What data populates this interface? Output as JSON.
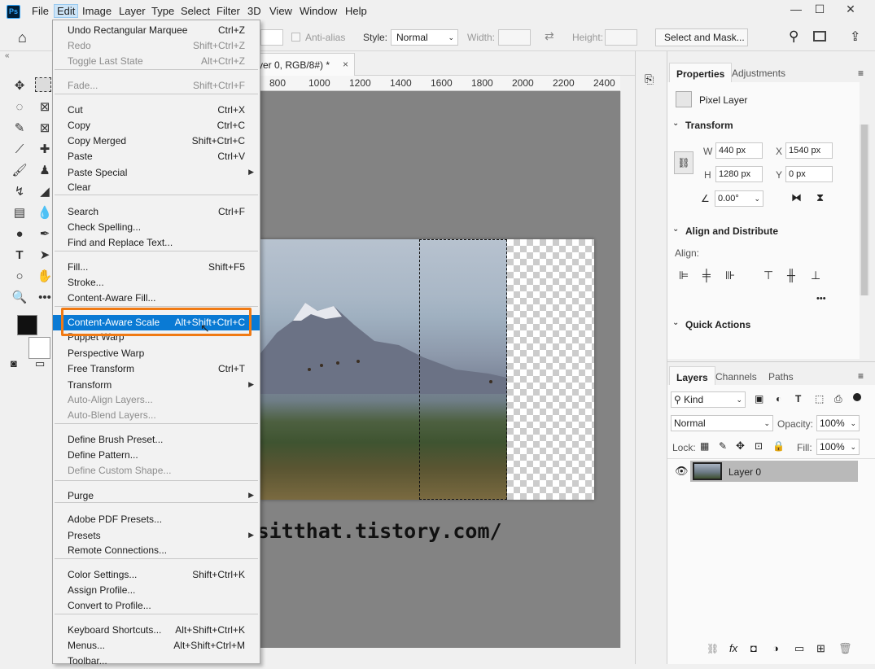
{
  "app": {
    "logo": "Ps"
  },
  "menubar": [
    "File",
    "Edit",
    "Image",
    "Layer",
    "Type",
    "Select",
    "Filter",
    "3D",
    "View",
    "Window",
    "Help"
  ],
  "window_controls": {
    "minimize": "—",
    "maximize": "☐",
    "close": "✕"
  },
  "options_bar": {
    "antialias_label": "Anti-alias",
    "style_label": "Style:",
    "style_value": "Normal",
    "width_label": "Width:",
    "height_label": "Height:",
    "select_mask_label": "Select and Mask..."
  },
  "doc_tab": {
    "title": "yer 0, RGB/8#) *",
    "close": "×"
  },
  "ruler_ticks": [
    "800",
    "1000",
    "1200",
    "1400",
    "1600",
    "1800",
    "2000",
    "2200",
    "2400"
  ],
  "watermark": "https://thisitthat.tistory.com/",
  "edit_menu": [
    {
      "label": "Undo Rectangular Marquee",
      "shortcut": "Ctrl+Z",
      "enabled": true
    },
    {
      "label": "Redo",
      "shortcut": "Shift+Ctrl+Z",
      "enabled": false
    },
    {
      "label": "Toggle Last State",
      "shortcut": "Alt+Ctrl+Z",
      "enabled": false
    },
    {
      "label": "Fade...",
      "shortcut": "Shift+Ctrl+F",
      "enabled": false
    },
    {
      "label": "Cut",
      "shortcut": "Ctrl+X",
      "enabled": true
    },
    {
      "label": "Copy",
      "shortcut": "Ctrl+C",
      "enabled": true
    },
    {
      "label": "Copy Merged",
      "shortcut": "Shift+Ctrl+C",
      "enabled": true
    },
    {
      "label": "Paste",
      "shortcut": "Ctrl+V",
      "enabled": true
    },
    {
      "label": "Paste Special",
      "shortcut": "",
      "enabled": true,
      "submenu": true
    },
    {
      "label": "Clear",
      "shortcut": "",
      "enabled": true
    },
    {
      "label": "Search",
      "shortcut": "Ctrl+F",
      "enabled": true
    },
    {
      "label": "Check Spelling...",
      "shortcut": "",
      "enabled": true
    },
    {
      "label": "Find and Replace Text...",
      "shortcut": "",
      "enabled": true
    },
    {
      "label": "Fill...",
      "shortcut": "Shift+F5",
      "enabled": true
    },
    {
      "label": "Stroke...",
      "shortcut": "",
      "enabled": true
    },
    {
      "label": "Content-Aware Fill...",
      "shortcut": "",
      "enabled": true
    },
    {
      "label": "Content-Aware Scale",
      "shortcut": "Alt+Shift+Ctrl+C",
      "enabled": true,
      "highlighted": true
    },
    {
      "label": "Puppet Warp",
      "shortcut": "",
      "enabled": true
    },
    {
      "label": "Perspective Warp",
      "shortcut": "",
      "enabled": true
    },
    {
      "label": "Free Transform",
      "shortcut": "Ctrl+T",
      "enabled": true
    },
    {
      "label": "Transform",
      "shortcut": "",
      "enabled": true,
      "submenu": true
    },
    {
      "label": "Auto-Align Layers...",
      "shortcut": "",
      "enabled": false
    },
    {
      "label": "Auto-Blend Layers...",
      "shortcut": "",
      "enabled": false
    },
    {
      "label": "Define Brush Preset...",
      "shortcut": "",
      "enabled": true
    },
    {
      "label": "Define Pattern...",
      "shortcut": "",
      "enabled": true
    },
    {
      "label": "Define Custom Shape...",
      "shortcut": "",
      "enabled": false
    },
    {
      "label": "Purge",
      "shortcut": "",
      "enabled": true,
      "submenu": true
    },
    {
      "label": "Adobe PDF Presets...",
      "shortcut": "",
      "enabled": true
    },
    {
      "label": "Presets",
      "shortcut": "",
      "enabled": true,
      "submenu": true
    },
    {
      "label": "Remote Connections...",
      "shortcut": "",
      "enabled": true
    },
    {
      "label": "Color Settings...",
      "shortcut": "Shift+Ctrl+K",
      "enabled": true
    },
    {
      "label": "Assign Profile...",
      "shortcut": "",
      "enabled": true
    },
    {
      "label": "Convert to Profile...",
      "shortcut": "",
      "enabled": true
    },
    {
      "label": "Keyboard Shortcuts...",
      "shortcut": "Alt+Shift+Ctrl+K",
      "enabled": true
    },
    {
      "label": "Menus...",
      "shortcut": "Alt+Shift+Ctrl+M",
      "enabled": true
    },
    {
      "label": "Toolbar...",
      "shortcut": "",
      "enabled": true
    }
  ],
  "properties": {
    "tabs": [
      "Properties",
      "Adjustments"
    ],
    "layer_type": "Pixel Layer",
    "transform_title": "Transform",
    "w_label": "W",
    "w_value": "440 px",
    "h_label": "H",
    "h_value": "1280 px",
    "x_label": "X",
    "x_value": "1540 px",
    "y_label": "Y",
    "y_value": "0 px",
    "angle_value": "0.00°",
    "align_title": "Align and Distribute",
    "align_label": "Align:",
    "more": "•••",
    "quick_actions_title": "Quick Actions"
  },
  "layers": {
    "tabs": [
      "Layers",
      "Channels",
      "Paths"
    ],
    "kind_label": "Kind",
    "blend_mode": "Normal",
    "opacity_label": "Opacity:",
    "opacity_value": "100%",
    "lock_label": "Lock:",
    "fill_label": "Fill:",
    "fill_value": "100%",
    "layer_name": "Layer 0",
    "footer_fx": "fx"
  }
}
